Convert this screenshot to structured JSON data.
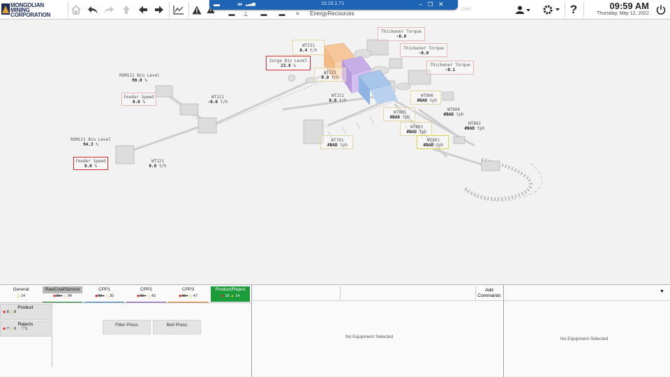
{
  "app": {
    "logo_line1": "MONGOLIAN",
    "logo_line2": "MINING",
    "logo_line3": "CORPORATION",
    "remote_ip": "10.10.1.71",
    "breadcrumb": "EnergyRecources",
    "user_label": "User:",
    "time": "09:59 AM",
    "date": "Thursday, May 12, 2022"
  },
  "tags": {
    "wt231": {
      "name": "WT231",
      "value": "0.4",
      "unit": "t/h"
    },
    "surge": {
      "name": "Surge Bin Level",
      "value": "23.8",
      "unit": "%"
    },
    "wt221": {
      "name": "WT221",
      "value": "0.0",
      "unit": "t/h"
    },
    "thk1": {
      "name": "Thickener Torque",
      "value": "-0.0"
    },
    "thk2": {
      "name": "Thickener Torque",
      "value": "-0.0"
    },
    "thk3": {
      "name": "Thickener Torque",
      "value": "-0.1"
    },
    "rom111": {
      "name": "ROM111 Bin Level",
      "value": "90.0",
      "unit": "%"
    },
    "feeder1": {
      "name": "Feeder Speed",
      "value": "0.0",
      "unit": "%"
    },
    "wt111": {
      "name": "WT111",
      "value": "-0.6",
      "unit": "t/h"
    },
    "wt211": {
      "name": "WT211",
      "value": "0.0",
      "unit": "t/h"
    },
    "wt806": {
      "name": "WT806",
      "value": "#BAD",
      "unit": "tph"
    },
    "wt805": {
      "name": "WT805",
      "value": "#BAD",
      "unit": "tph"
    },
    "wt804": {
      "name": "WT804",
      "value": "#BAD",
      "unit": "tph"
    },
    "wt803": {
      "name": "WT803",
      "value": "#BAD",
      "unit": "tph"
    },
    "wt802": {
      "name": "WT802",
      "value": "#BAD",
      "unit": "tph"
    },
    "wt801": {
      "name": "WT801",
      "value": "#BAD",
      "unit": "tph"
    },
    "wt701": {
      "name": "WT701",
      "value": "#BAD",
      "unit": "tph"
    },
    "rom121": {
      "name": "ROM121 Bin Level",
      "value": "94.3",
      "unit": "%"
    },
    "feeder2": {
      "name": "Feeder Speed",
      "value": "0.0",
      "unit": "%"
    },
    "wt121": {
      "name": "WT121",
      "value": "0.0",
      "unit": "t/h"
    }
  },
  "area_tabs": [
    {
      "name": "General",
      "alarms": "14",
      "color": ""
    },
    {
      "name": "RawCoal/Service",
      "alarms": "99+",
      "alarms2": "94",
      "color": "#1f8a3c"
    },
    {
      "name": "CPP1",
      "alarms": "99+",
      "alarms2": "30",
      "color": "#2f7fc8"
    },
    {
      "name": "CPP2",
      "alarms": "99+",
      "alarms2": "43",
      "color": "#8a4fc4"
    },
    {
      "name": "CPP3",
      "alarms": "99+",
      "alarms2": "47",
      "color": "#e07b1a"
    },
    {
      "name": "Product/Reject",
      "alarms": "15",
      "alarms2": "14",
      "color": "#1c9b3a"
    }
  ],
  "sub": {
    "product": {
      "label": "Product",
      "alarms": "8",
      "alarms2": "8"
    },
    "rejects": {
      "label": "Rejects",
      "alarms": "7",
      "alarms2": "6",
      "alarms3": "1"
    }
  },
  "equip_buttons": [
    "Filter Press",
    "Belt Press"
  ],
  "add_commands": "Add Commands",
  "no_equipment": "No Equipment Selected"
}
